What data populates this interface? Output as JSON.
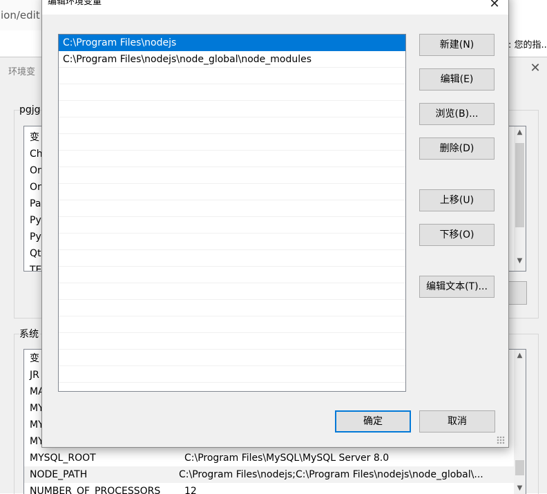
{
  "background": {
    "url_fragment": "ion/edit",
    "notice_fragment": ": 您的指...",
    "env_dialog": {
      "title": "环境变",
      "user_group_label": "pgjg",
      "user_vars": [
        "变",
        "Ch",
        "Or",
        "Or",
        "Pa",
        "Py",
        "Py",
        "Qt",
        "TE"
      ],
      "system_group_label": "系统",
      "system_vars": [
        {
          "name": "变",
          "value": ""
        },
        {
          "name": "JR",
          "value": ""
        },
        {
          "name": "MA",
          "value": ""
        },
        {
          "name": "MY",
          "value": ""
        },
        {
          "name": "MY",
          "value": ""
        },
        {
          "name": "MY",
          "value": ""
        },
        {
          "name": "MYSQL_ROOT",
          "value": "C:\\Program Files\\MySQL\\MySQL Server 8.0"
        },
        {
          "name": "NODE_PATH",
          "value": "C:\\Program Files\\nodejs;C:\\Program Files\\nodejs\\node_global\\..."
        },
        {
          "name": "NUMBER_OF_PROCESSORS",
          "value": "12"
        }
      ]
    }
  },
  "edit_dialog": {
    "title": "编辑环境变量",
    "close_glyph": "✕",
    "paths": [
      "C:\\Program Files\\nodejs",
      "C:\\Program Files\\nodejs\\node_global\\node_modules"
    ],
    "selected_index": 0,
    "buttons": {
      "new": "新建(N)",
      "edit": "编辑(E)",
      "browse": "浏览(B)...",
      "delete": "删除(D)",
      "move_up": "上移(U)",
      "move_down": "下移(O)",
      "edit_text": "编辑文本(T)...",
      "ok": "确定",
      "cancel": "取消"
    }
  }
}
